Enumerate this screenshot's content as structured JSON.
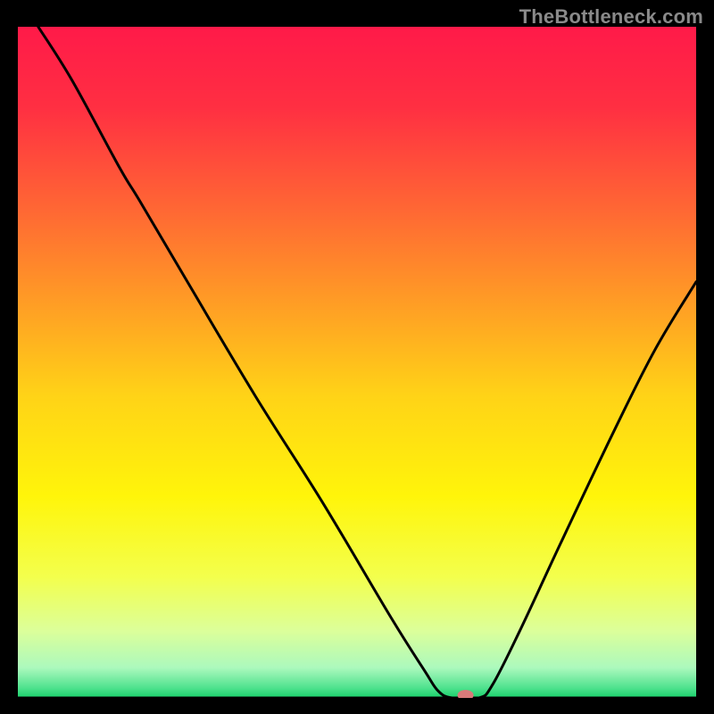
{
  "watermark": "TheBottleneck.com",
  "chart_data": {
    "type": "line",
    "title": "",
    "xlabel": "",
    "ylabel": "",
    "xlim": [
      0,
      100
    ],
    "ylim": [
      0,
      100
    ],
    "grid": false,
    "legend": false,
    "background": {
      "kind": "vertical-gradient",
      "stops": [
        {
          "offset": 0.0,
          "color": "#ff1a49"
        },
        {
          "offset": 0.12,
          "color": "#ff2f42"
        },
        {
          "offset": 0.28,
          "color": "#ff6a33"
        },
        {
          "offset": 0.42,
          "color": "#ffa024"
        },
        {
          "offset": 0.55,
          "color": "#ffd317"
        },
        {
          "offset": 0.7,
          "color": "#fff50a"
        },
        {
          "offset": 0.82,
          "color": "#f3ff4d"
        },
        {
          "offset": 0.9,
          "color": "#dcff9a"
        },
        {
          "offset": 0.955,
          "color": "#acf9bd"
        },
        {
          "offset": 0.985,
          "color": "#4fe28e"
        },
        {
          "offset": 1.0,
          "color": "#18d06a"
        }
      ]
    },
    "series": [
      {
        "name": "bottleneck-curve",
        "color": "#000000",
        "stroke_width": 3,
        "x": [
          3,
          8,
          15,
          18,
          25,
          35,
          45,
          55,
          60,
          62,
          64,
          68,
          70,
          74,
          80,
          88,
          94,
          100
        ],
        "y": [
          100,
          92,
          79,
          74,
          62,
          45,
          29,
          12,
          4,
          1,
          0,
          0,
          2,
          10,
          23,
          40,
          52,
          62
        ]
      }
    ],
    "marker": {
      "name": "current-point",
      "x": 66,
      "y": 0,
      "rx": 9,
      "ry": 6,
      "color": "#d97a7a"
    },
    "baseline": {
      "y": 0,
      "color": "#000000",
      "stroke_width": 3
    }
  }
}
